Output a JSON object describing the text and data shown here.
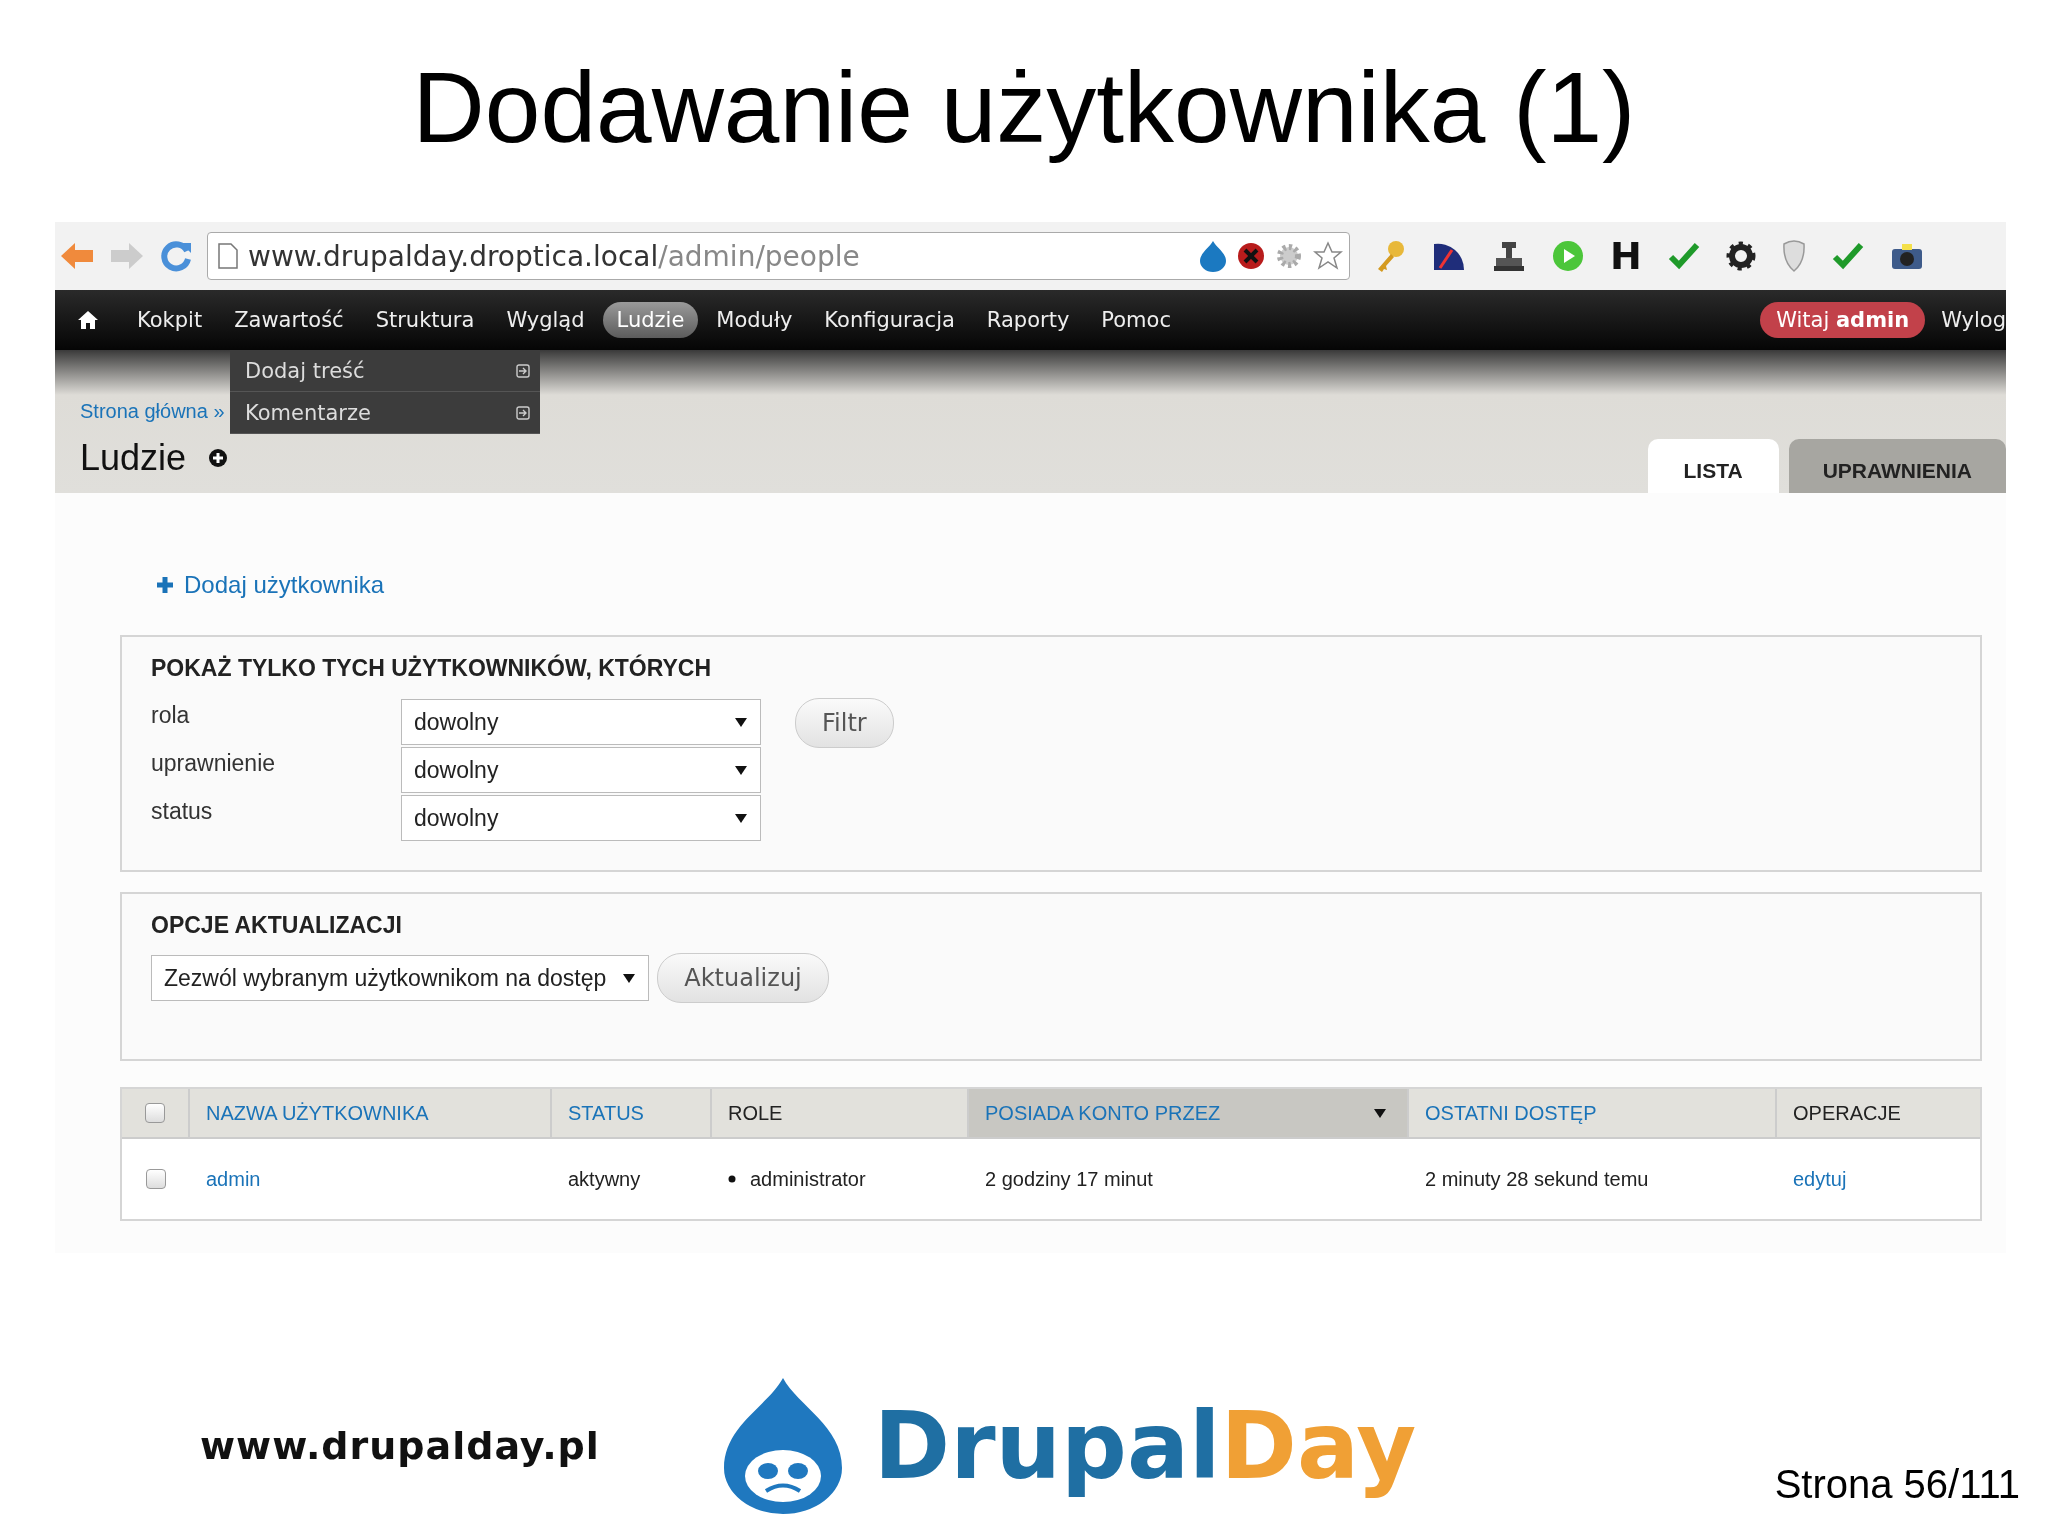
{
  "slide": {
    "title": "Dodawanie użytkownika (1)",
    "footer_url": "www.drupalday.pl",
    "logo_word_1": "Drupal",
    "logo_word_2": "Day",
    "page_number": "Strona 56/111"
  },
  "browser": {
    "url_host": "www.drupalday.droptica.local",
    "url_path": "/admin/people",
    "extension_label": "H"
  },
  "toolbar": {
    "items": [
      {
        "label": "Kokpit",
        "selected": false
      },
      {
        "label": "Zawartość",
        "selected": false
      },
      {
        "label": "Struktura",
        "selected": false
      },
      {
        "label": "Wygląd",
        "selected": false
      },
      {
        "label": "Ludzie",
        "selected": true
      },
      {
        "label": "Moduły",
        "selected": false
      },
      {
        "label": "Konfiguracja",
        "selected": false
      },
      {
        "label": "Raporty",
        "selected": false
      },
      {
        "label": "Pomoc",
        "selected": false
      }
    ],
    "greeting": "Witaj **admin**",
    "logout": "Wylog"
  },
  "dropdown": [
    {
      "label": "Dodaj treść"
    },
    {
      "label": "Komentarze"
    }
  ],
  "breadcrumb": "Strona główna »",
  "page_title": "Ludzie",
  "tabs": [
    {
      "label": "LISTA",
      "selected": true
    },
    {
      "label": "UPRAWNIENIA",
      "selected": false
    }
  ],
  "add_link": "Dodaj użytkownika",
  "filter": {
    "legend": "POKAŻ TYLKO TYCH UŻYTKOWNIKÓW, KTÓRYCH",
    "fields": [
      {
        "label": "rola",
        "value": "dowolny"
      },
      {
        "label": "uprawnienie",
        "value": "dowolny"
      },
      {
        "label": "status",
        "value": "dowolny"
      }
    ],
    "button": "Filtr"
  },
  "update": {
    "legend": "OPCJE AKTUALIZACJI",
    "value": "Zezwól wybranym użytkownikom na dostęp",
    "button": "Aktualizuj"
  },
  "table": {
    "select_all_checked": false,
    "columns": [
      {
        "label": "NAZWA UŻYTKOWNIKA",
        "sortable": true,
        "sorted": false
      },
      {
        "label": "STATUS",
        "sortable": true,
        "sorted": false
      },
      {
        "label": "ROLE",
        "sortable": false,
        "sorted": false
      },
      {
        "label": "POSIADA KONTO PRZEZ",
        "sortable": true,
        "sorted": true
      },
      {
        "label": "OSTATNI DOSTĘP",
        "sortable": true,
        "sorted": false
      },
      {
        "label": "OPERACJE",
        "sortable": false,
        "sorted": false
      }
    ],
    "rows": [
      {
        "checked": false,
        "cells": [
          {
            "kind": "link",
            "text": "admin"
          },
          {
            "kind": "text",
            "text": "aktywny"
          },
          {
            "kind": "bullet",
            "text": "administrator"
          },
          {
            "kind": "text",
            "text": "2 godziny 17 minut"
          },
          {
            "kind": "text",
            "text": "2 minuty 28 sekund temu"
          },
          {
            "kind": "link",
            "text": "edytuj"
          }
        ]
      }
    ]
  }
}
